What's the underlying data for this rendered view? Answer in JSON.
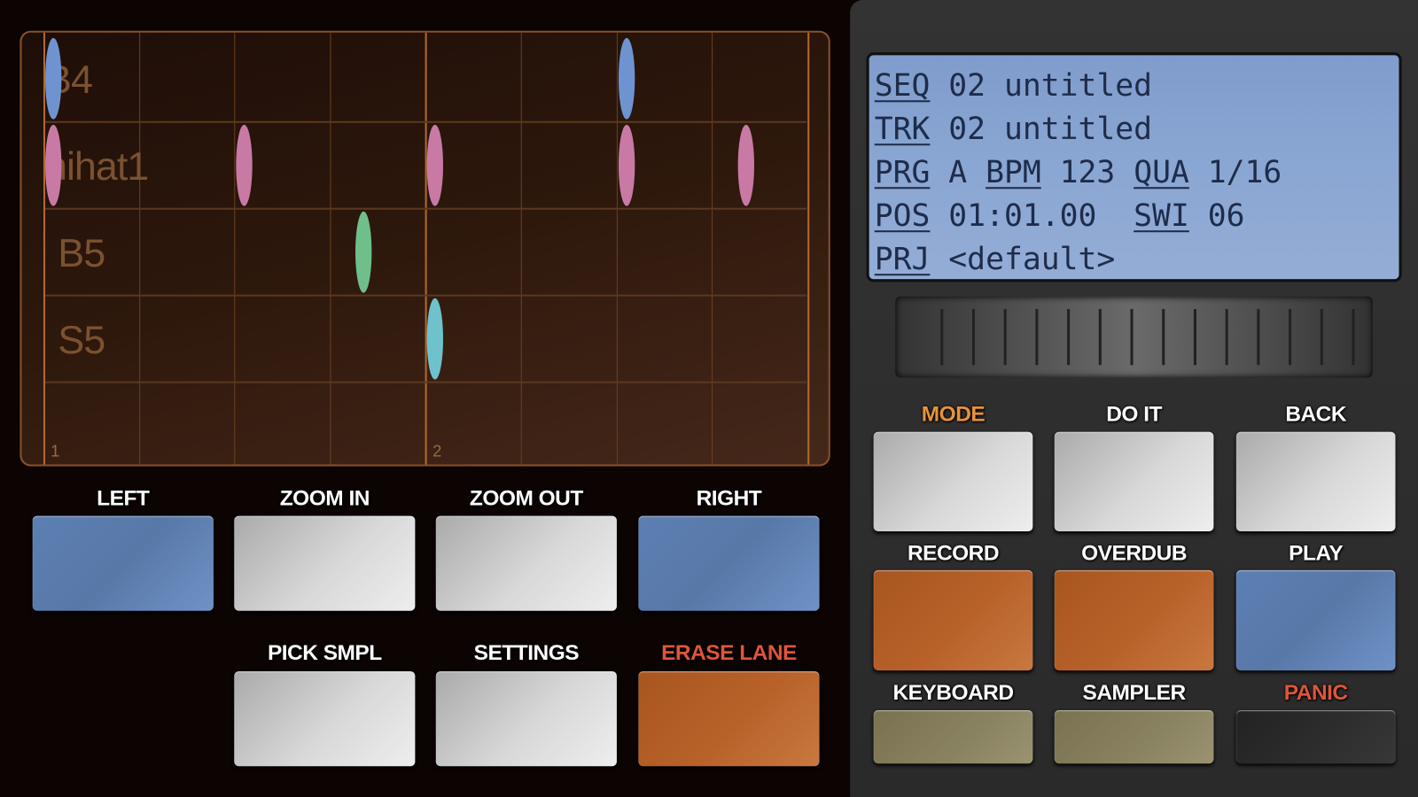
{
  "sequencer": {
    "lanes": [
      {
        "name": "B4",
        "color": "#6f93d0",
        "steps": [
          0,
          6
        ]
      },
      {
        "name": "hihat1",
        "color": "#c87aa4",
        "steps": [
          0,
          2,
          4,
          6,
          7.25
        ]
      },
      {
        "name": "B5",
        "color": "#6fbf8a",
        "steps": [
          3.25
        ]
      },
      {
        "name": "S5",
        "color": "#6fc2cc",
        "steps": [
          4
        ]
      }
    ],
    "bar_numbers": [
      "1",
      "2"
    ],
    "columns_per_bar": 4,
    "visible_columns": 8
  },
  "left_buttons": [
    {
      "label": "LEFT",
      "color": "blue",
      "label_color": "#ffffff"
    },
    {
      "label": "ZOOM IN",
      "color": "gray",
      "label_color": "#ffffff"
    },
    {
      "label": "ZOOM OUT",
      "color": "gray",
      "label_color": "#ffffff"
    },
    {
      "label": "RIGHT",
      "color": "blue",
      "label_color": "#ffffff"
    },
    {
      "label": "PICK SMPL",
      "color": "gray",
      "label_color": "#ffffff"
    },
    {
      "label": "SETTINGS",
      "color": "gray",
      "label_color": "#ffffff"
    },
    {
      "label": "ERASE LANE",
      "color": "orange",
      "label_color": "#e0553a"
    }
  ],
  "lcd": {
    "seq_key": "SEQ",
    "seq_value": " 02 untitled",
    "trk_key": "TRK",
    "trk_value": " 02 untitled",
    "prg_key": "PRG",
    "prg_value": " A ",
    "bpm_key": "BPM",
    "bpm_value": " 123 ",
    "qua_key": "QUA",
    "qua_value": " 1/16",
    "pos_key": "POS",
    "pos_value": " 01:01.00  ",
    "swi_key": "SWI",
    "swi_value": " 06",
    "prj_key": "PRJ",
    "prj_value": " <default>"
  },
  "right_buttons": [
    {
      "label": "MODE",
      "color": "gray",
      "label_color": "#e8923a"
    },
    {
      "label": "DO IT",
      "color": "gray",
      "label_color": "#ffffff"
    },
    {
      "label": "BACK",
      "color": "gray",
      "label_color": "#ffffff"
    },
    {
      "label": "RECORD",
      "color": "orange",
      "label_color": "#ffffff"
    },
    {
      "label": "OVERDUB",
      "color": "orange",
      "label_color": "#ffffff"
    },
    {
      "label": "PLAY",
      "color": "blue",
      "label_color": "#ffffff"
    },
    {
      "label": "KEYBOARD",
      "color": "khaki",
      "label_color": "#ffffff"
    },
    {
      "label": "SAMPLER",
      "color": "khaki",
      "label_color": "#ffffff"
    },
    {
      "label": "PANIC",
      "color": "dark",
      "label_color": "#e0553a"
    }
  ]
}
